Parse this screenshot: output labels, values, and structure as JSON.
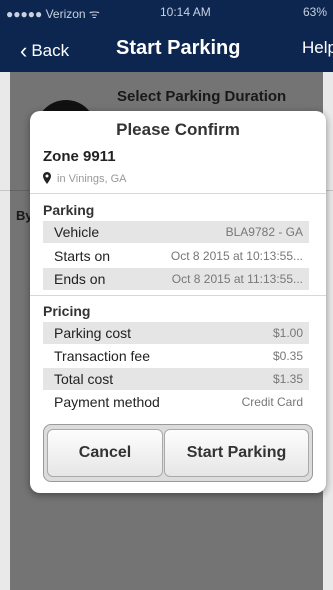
{
  "status_bar": {
    "carrier": "●●●●● Verizon ᯤ",
    "time": "10:14 AM",
    "battery": "63%"
  },
  "nav": {
    "back_label": "Back",
    "title": "Start Parking",
    "help_label": "Help"
  },
  "background": {
    "duration_label": "Select Parking Duration",
    "by_label": "By"
  },
  "dialog": {
    "title": "Please Confirm",
    "zone": "Zone 9911",
    "location": "in Vinings, GA",
    "parking_header": "Parking",
    "parking_rows": [
      {
        "label": "Vehicle",
        "value": "BLA9782 - GA"
      },
      {
        "label": "Starts on",
        "value": "Oct 8 2015 at 10:13:55..."
      },
      {
        "label": "Ends on",
        "value": "Oct 8 2015 at 11:13:55..."
      }
    ],
    "pricing_header": "Pricing",
    "pricing_rows": [
      {
        "label": "Parking cost",
        "value": "$1.00"
      },
      {
        "label": "Transaction fee",
        "value": "$0.35"
      },
      {
        "label": "Total cost",
        "value": "$1.35"
      },
      {
        "label": "Payment method",
        "value": "Credit Card"
      }
    ],
    "cancel_label": "Cancel",
    "start_label": "Start Parking"
  }
}
